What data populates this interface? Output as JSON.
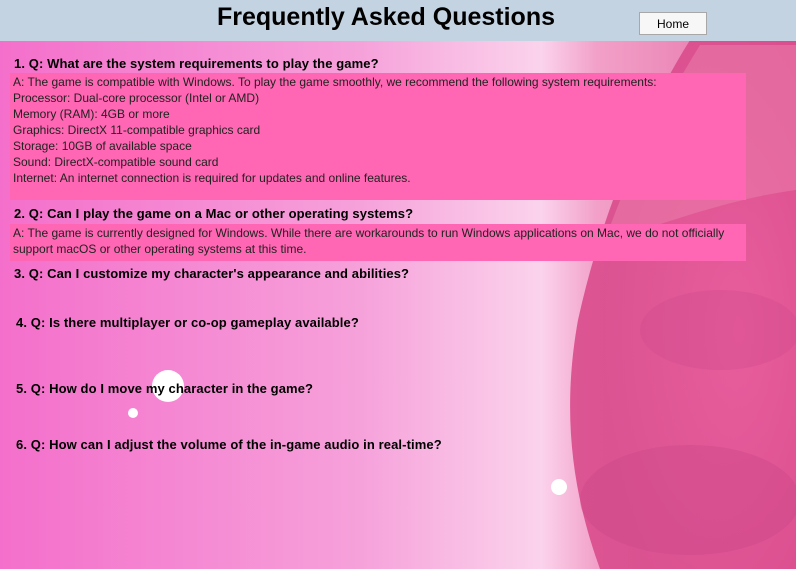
{
  "header": {
    "title": "Frequently Asked Questions",
    "home_label": "Home"
  },
  "faqs": [
    {
      "question": "1. Q: What are the system requirements to play the game?",
      "answer_lines": [
        "A: The game is compatible with Windows. To play the game smoothly, we recommend the following system requirements:",
        "Processor: Dual-core processor (Intel or AMD)",
        "Memory (RAM): 4GB or more",
        "Graphics: DirectX 11-compatible graphics card",
        "Storage: 10GB of available space",
        "Sound: DirectX-compatible sound card",
        "Internet: An internet connection is required for updates and online features."
      ]
    },
    {
      "question": "2. Q: Can I play the game on a Mac or other operating systems?",
      "answer": "A: The game is currently designed for Windows. While there are workarounds to run Windows applications on Mac, we do not officially support macOS or other operating systems at this time."
    },
    {
      "question": "3. Q: Can I customize my character's appearance and abilities?"
    },
    {
      "question": "4. Q: Is there multiplayer or co-op gameplay available?"
    },
    {
      "question": "5. Q: How do I move my character in the game?"
    },
    {
      "question": "6. Q: How can I adjust the volume of the in-game audio in real-time?"
    }
  ],
  "colors": {
    "header_bg": "#c4d3e2",
    "answer_bg": "#ff66b3",
    "page_bg": "#f07ccd"
  }
}
